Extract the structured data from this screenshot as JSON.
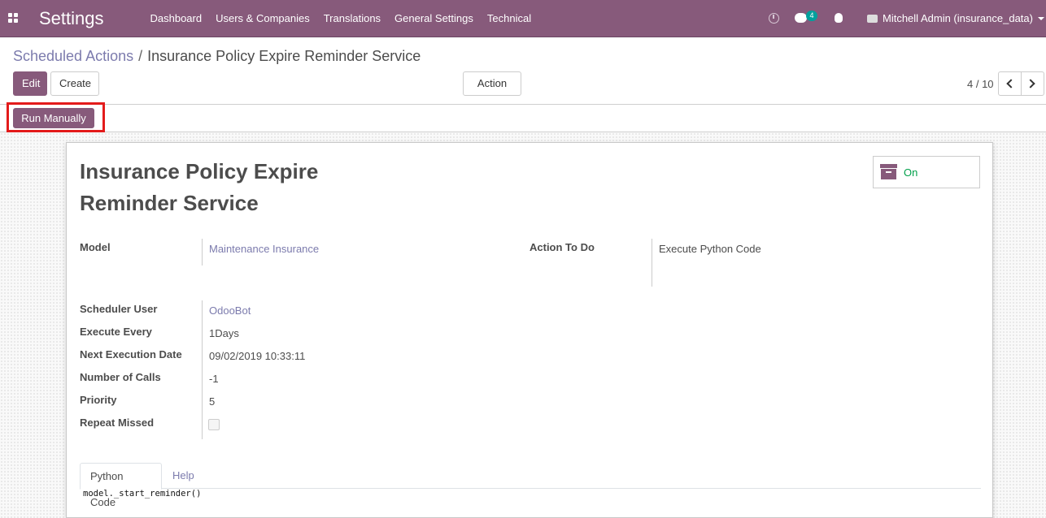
{
  "navbar": {
    "app_title": "Settings",
    "menu": [
      "Dashboard",
      "Users & Companies",
      "Translations",
      "General Settings",
      "Technical"
    ],
    "chat_count": "4",
    "user": "Mitchell Admin (insurance_data)",
    "icons": [
      "apps-icon",
      "clock-icon",
      "chat-icon",
      "bug-icon",
      "camera-icon"
    ]
  },
  "breadcrumb": {
    "parent": "Scheduled Actions",
    "separator": "/",
    "current": "Insurance Policy Expire Reminder Service"
  },
  "buttons": {
    "edit": "Edit",
    "create": "Create",
    "action": "Action",
    "run_manually": "Run Manually"
  },
  "pager": {
    "value": "4 / 10"
  },
  "record": {
    "title_line1": "Insurance Policy Expire",
    "title_line2": "Reminder Service",
    "active_label": "On",
    "fields": {
      "model_label": "Model",
      "model_value": "Maintenance Insurance",
      "action_label": "Action To Do",
      "action_value": "Execute Python Code",
      "user_label": "Scheduler User",
      "user_value": "OdooBot",
      "every_label": "Execute Every",
      "every_value": "1Days",
      "next_label": "Next Execution Date",
      "next_value": "09/02/2019 10:33:11",
      "calls_label": "Number of Calls",
      "calls_value": "-1",
      "priority_label": "Priority",
      "priority_value": "5",
      "repeat_label": "Repeat Missed",
      "repeat_value": false
    },
    "tabs": [
      "Python Code",
      "Help"
    ],
    "code": "model._start_reminder()"
  },
  "colors": {
    "brand": "#875a7b",
    "link": "#7c7bad",
    "active": "#00a04a",
    "highlight": "#e31b1b",
    "badge": "#00a09d"
  }
}
